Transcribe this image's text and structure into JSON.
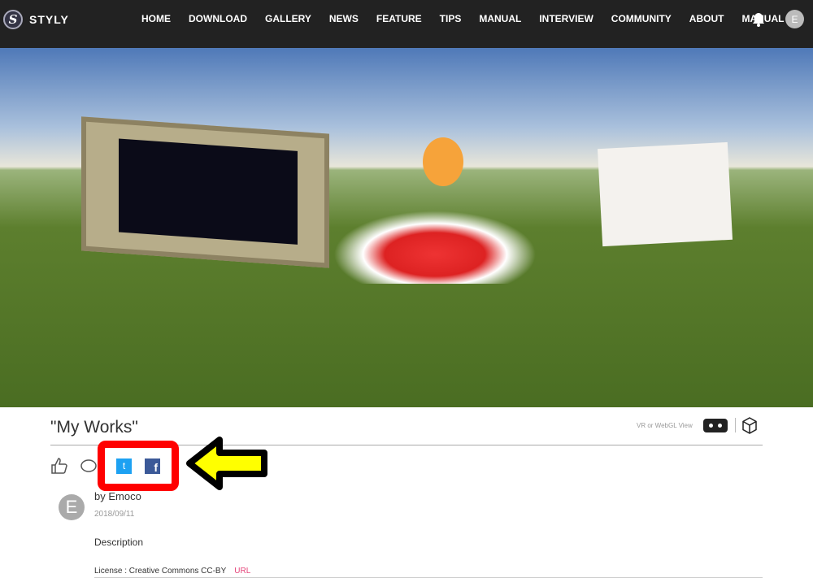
{
  "header": {
    "logo_letter": "S",
    "logo_text": "STYLY",
    "menu": [
      "HOME",
      "DOWNLOAD",
      "GALLERY",
      "NEWS",
      "FEATURE",
      "TIPS",
      "MANUAL",
      "INTERVIEW",
      "COMMUNITY",
      "ABOUT",
      "MANUAL"
    ],
    "avatar_letter": "E"
  },
  "work": {
    "title": "\"My Works\"",
    "view_label": "VR or WebGL View",
    "author": "by Emoco",
    "avatar_letter": "E",
    "date": "2018/09/11",
    "description": "Description",
    "license": "License : Creative Commons CC-BY",
    "license_link": "URL"
  },
  "share": {
    "twitter_glyph": "t",
    "facebook_glyph": "f"
  },
  "colors": {
    "highlight_box": "#ff0000",
    "arrow": "#ffff00",
    "link": "#e5457a",
    "twitter": "#1da1f2",
    "facebook": "#3b5998"
  }
}
